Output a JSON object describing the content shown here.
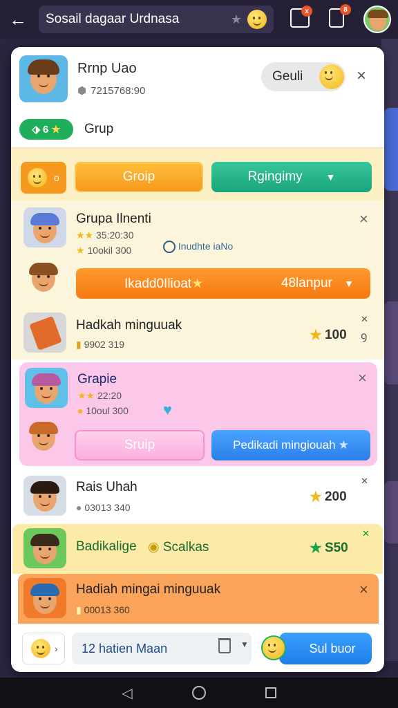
{
  "topbar": {
    "title": "Sosail dagaar Urdnasa",
    "star": "★",
    "badge_a": "x",
    "badge_b": "8"
  },
  "header": {
    "name": "Rrnp Uao",
    "id_text": "7215768:90",
    "pill_label": "Geuli",
    "close": "×",
    "tag_text": "6",
    "tag_label": "Grup"
  },
  "row1": {
    "btn_a": "Groip",
    "btn_b": "Rgingimy",
    "left_chip": "o"
  },
  "row2": {
    "name": "Grupa Ilnenti",
    "rating": "35:20:30",
    "count": "10okil 300",
    "badge_text": "Inudhte iaNo",
    "button": "Ikadd0Ilioat",
    "button_value": "48lanpur",
    "close": "×"
  },
  "row3": {
    "name": "Hadkah minguuak",
    "meta": "9902 319",
    "amount": "100",
    "mini": "ꝯ",
    "corner": "✕"
  },
  "row4": {
    "name": "Grapie",
    "rating": "22:20",
    "count": "10oul 300",
    "btn_a": "Sruip",
    "btn_b": "Pedikadi mingiouah",
    "close": "×"
  },
  "row5": {
    "name": "Rais Uhah",
    "meta": "03013 340",
    "amount": "200",
    "corner": "✕"
  },
  "row6": {
    "name": "Badikalige",
    "label": "Scalkas",
    "amount": "S50",
    "corner": "✕"
  },
  "row7": {
    "name": "Hadiah mingai minguuak",
    "meta": "00013 360",
    "close": "×"
  },
  "footer": {
    "input_text": "12 hatien Maan",
    "send_label": "Sul buor"
  },
  "colors": {
    "accent_orange": "#f59a1e",
    "accent_green": "#1aa47a",
    "accent_pink": "#fab0dc",
    "accent_blue": "#2b7fe8"
  }
}
